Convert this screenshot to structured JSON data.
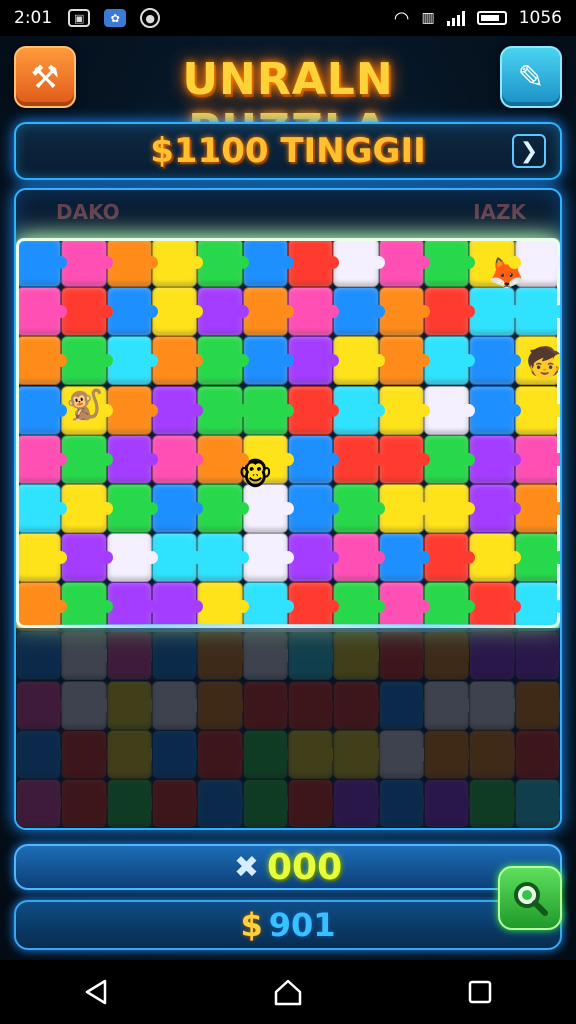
{
  "status_bar": {
    "time": "2:01",
    "battery_level": "1056",
    "icons": [
      "gallery-icon",
      "photos-icon",
      "record-icon",
      "wifi-icon",
      "signal-icon",
      "battery-icon"
    ]
  },
  "header": {
    "title": "UNRALN PUZZLA",
    "left_button_icon": "hammer-icon",
    "right_button_icon": "tool-icon"
  },
  "banner": {
    "text": "$1100 TINGGII",
    "arrow_icon": "chevron-right-icon"
  },
  "board": {
    "label_left": "DAKO",
    "label_right": "IAZK",
    "rows": 12,
    "cols": 12,
    "lit_rows": 8,
    "colors": {
      "red": "#ff3b2f",
      "orange": "#ff8c1a",
      "yellow": "#ffe31a",
      "green": "#27d84a",
      "blue": "#1e8fff",
      "pink": "#ff4fb4",
      "purple": "#a43dff",
      "white": "#f4f0ff",
      "cyan": "#2fe3ff"
    }
  },
  "footer": {
    "score_icon": "crossed-tools-icon",
    "score_value": "000",
    "money_symbol": "$",
    "money_value": "901",
    "search_icon": "search-icon"
  },
  "nav": {
    "back_icon": "back-icon",
    "home_icon": "home-icon",
    "recent_icon": "recents-icon"
  }
}
